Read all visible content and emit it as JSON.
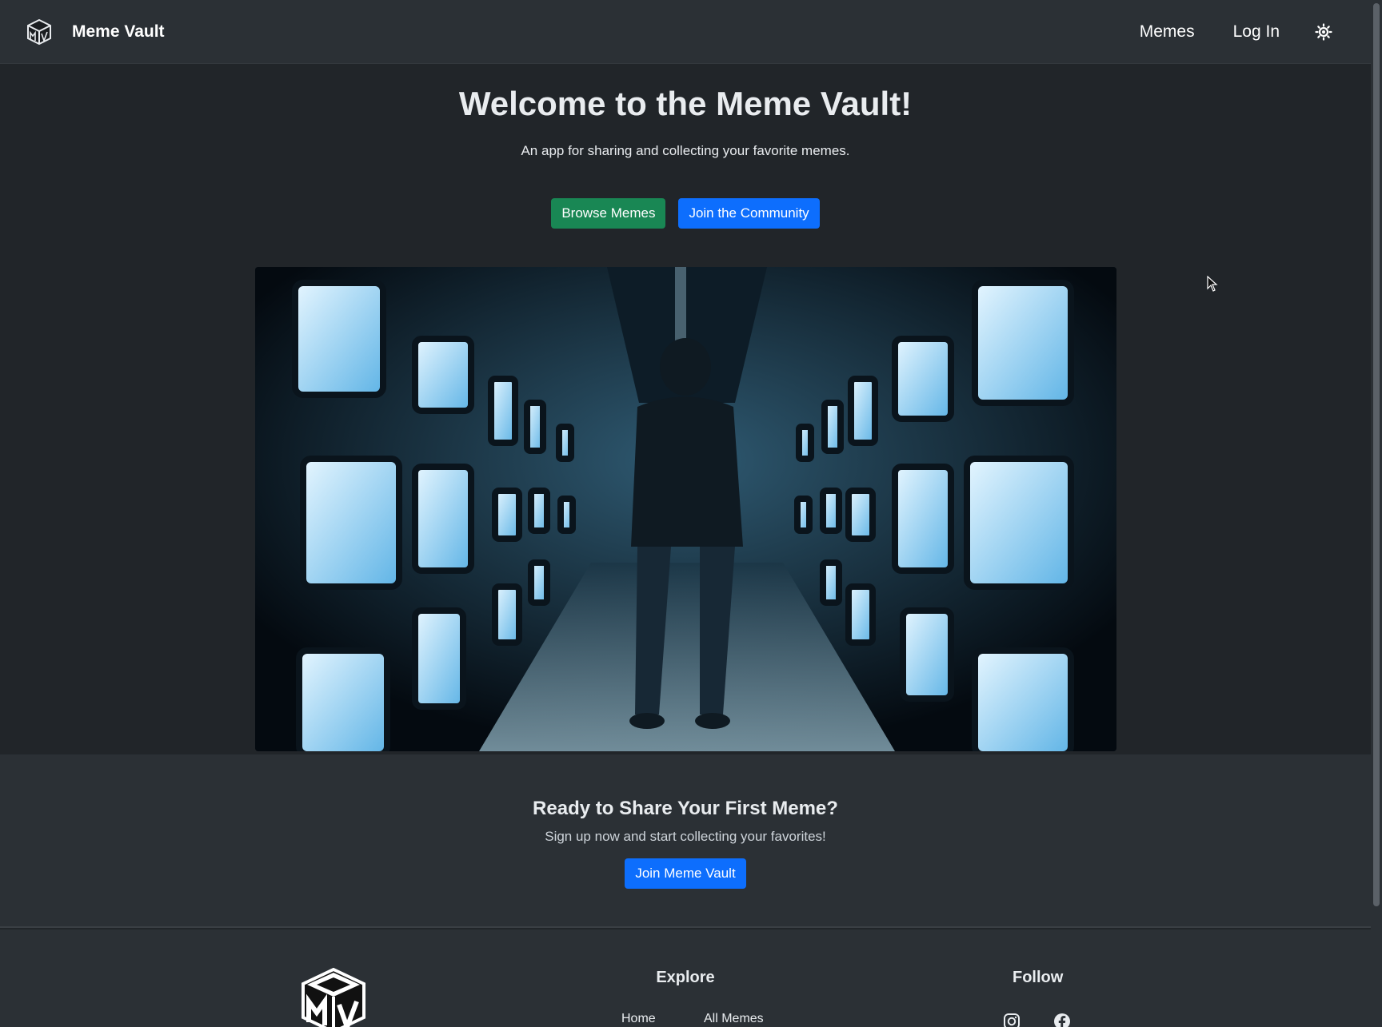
{
  "navbar": {
    "brand_name": "Meme Vault",
    "logo_icon": "mv-cube-icon",
    "links": [
      "Memes",
      "Log In"
    ],
    "theme_icon": "sun-icon"
  },
  "hero": {
    "title": "Welcome to the Meme Vault!",
    "subtitle": "An app for sharing and collecting your favorite memes.",
    "browse_button": "Browse Memes",
    "community_button": "Join the Community",
    "image_label": "Corridor of TV screens with person walking"
  },
  "cta": {
    "title": "Ready to Share Your First Meme?",
    "subtitle": "Sign up now and start collecting your favorites!",
    "button": "Join Meme Vault"
  },
  "footer": {
    "explore_title": "Explore",
    "explore_links": [
      "Home",
      "All Memes"
    ],
    "follow_title": "Follow",
    "social_icons": [
      "instagram-icon",
      "facebook-icon"
    ]
  },
  "colors": {
    "background": "#212529",
    "surface": "#2b3035",
    "primary": "#0d6efd",
    "success": "#198754"
  }
}
